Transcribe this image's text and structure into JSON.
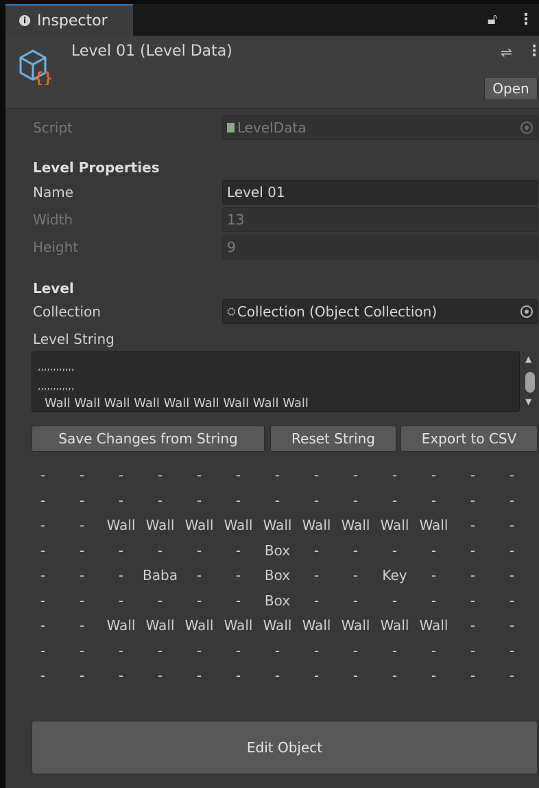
{
  "tab": {
    "title": "Inspector"
  },
  "header": {
    "title": "Level 01 (Level Data)",
    "open_label": "Open"
  },
  "script": {
    "label": "Script",
    "value": "LevelData"
  },
  "level_properties": {
    "heading": "Level Properties",
    "name_label": "Name",
    "name_value": "Level 01",
    "width_label": "Width",
    "width_value": "13",
    "height_label": "Height",
    "height_value": "9"
  },
  "level": {
    "heading": "Level",
    "collection_label": "Collection",
    "collection_value": "Collection (Object Collection)",
    "level_string_label": "Level String",
    "level_string_lines": [
      ",,,,,,,,,,,,",
      ",,,,,,,,,,,,",
      "Wall Wall Wall Wall Wall Wall Wall Wall Wall"
    ]
  },
  "buttons": {
    "save": "Save Changes from String",
    "reset": "Reset String",
    "export": "Export to CSV"
  },
  "grid": [
    [
      "-",
      "-",
      "-",
      "-",
      "-",
      "-",
      "-",
      "-",
      "-",
      "-",
      "-",
      "-",
      "-"
    ],
    [
      "-",
      "-",
      "-",
      "-",
      "-",
      "-",
      "-",
      "-",
      "-",
      "-",
      "-",
      "-",
      "-"
    ],
    [
      "-",
      "-",
      "Wall",
      "Wall",
      "Wall",
      "Wall",
      "Wall",
      "Wall",
      "Wall",
      "Wall",
      "Wall",
      "-",
      "-"
    ],
    [
      "-",
      "-",
      "-",
      "-",
      "-",
      "-",
      "Box",
      "-",
      "-",
      "-",
      "-",
      "-",
      "-"
    ],
    [
      "-",
      "-",
      "-",
      "Baba",
      "-",
      "-",
      "Box",
      "-",
      "-",
      "Key",
      "-",
      "-",
      "-"
    ],
    [
      "-",
      "-",
      "-",
      "-",
      "-",
      "-",
      "Box",
      "-",
      "-",
      "-",
      "-",
      "-",
      "-"
    ],
    [
      "-",
      "-",
      "Wall",
      "Wall",
      "Wall",
      "Wall",
      "Wall",
      "Wall",
      "Wall",
      "Wall",
      "Wall",
      "-",
      "-"
    ],
    [
      "-",
      "-",
      "-",
      "-",
      "-",
      "-",
      "-",
      "-",
      "-",
      "-",
      "-",
      "-",
      "-"
    ],
    [
      "-",
      "-",
      "-",
      "-",
      "-",
      "-",
      "-",
      "-",
      "-",
      "-",
      "-",
      "-",
      "-"
    ]
  ],
  "edit_object_label": "Edit Object",
  "colors": {
    "background": "#383838",
    "tab_accent": "#3a79bb",
    "button": "#585858",
    "icon_accent": "#e8672d",
    "icon_main": "#6fb3e8"
  },
  "icons": [
    "info-icon",
    "lock-icon",
    "kebab-menu-icon",
    "settings-icon",
    "scriptable-object-icon",
    "script-file-icon",
    "object-picker-icon",
    "collection-icon"
  ]
}
